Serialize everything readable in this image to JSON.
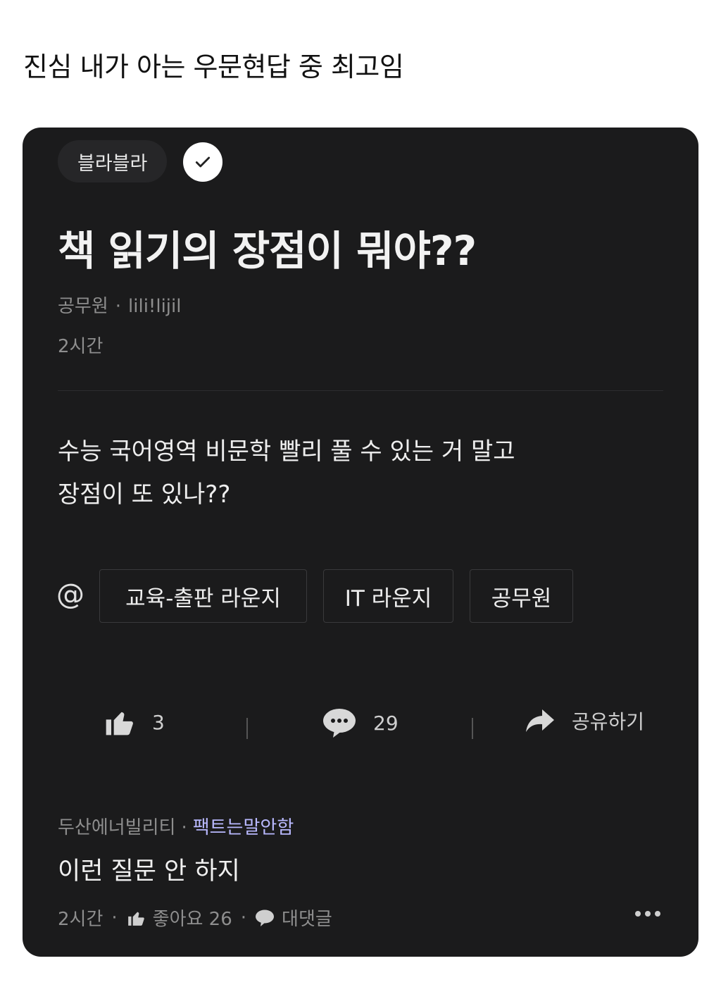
{
  "caption": "진심 내가 아는 우문현답 중 최고임",
  "post": {
    "community_label": "블라블라",
    "title": "책 읽기의 장점이 뭐야??",
    "author_company": "공무원",
    "author_nick": "lili!lijil",
    "time": "2시간",
    "body_line1": "수능 국어영역 비문학 빨리 풀 수 있는 거 말고",
    "body_line2": "장점이 또 있나??",
    "at_symbol": "@",
    "tags": [
      "교육-출판 라운지",
      "IT 라운지",
      "공무원"
    ],
    "likes": "3",
    "comments": "29",
    "share_label": "공유하기"
  },
  "comment": {
    "company": "두산에너빌리티",
    "nick": "팩트는말안함",
    "text": "이런 질문 안 하지",
    "time": "2시간",
    "likes_label": "좋아요 26",
    "reply_label": "대댓글"
  },
  "colors": {
    "card_bg": "#1b1b1c",
    "nick_accent": "#b9b9ff"
  }
}
